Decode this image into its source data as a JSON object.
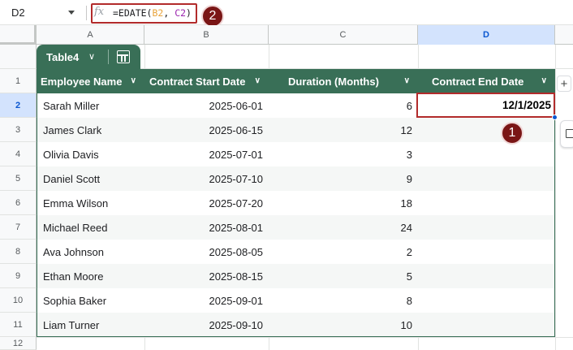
{
  "formula_bar": {
    "cell_ref": "D2",
    "fx_label": "fx",
    "formula_prefix": "=EDATE(",
    "arg1": "B2",
    "sep": ", ",
    "arg2": "C2",
    "formula_suffix": ")"
  },
  "markers": {
    "one": "1",
    "two": "2"
  },
  "columns": [
    "A",
    "B",
    "C",
    "D"
  ],
  "rows": [
    "1",
    "2",
    "3",
    "4",
    "5",
    "6",
    "7",
    "8",
    "9",
    "10",
    "11",
    "12"
  ],
  "table": {
    "name": "Table4",
    "headers": [
      "Employee Name",
      "Contract Start Date",
      "Duration (Months)",
      "Contract End Date"
    ],
    "rows": [
      [
        "Sarah Miller",
        "2025-06-01",
        "6",
        "12/1/2025"
      ],
      [
        "James Clark",
        "2025-06-15",
        "12",
        ""
      ],
      [
        "Olivia Davis",
        "2025-07-01",
        "3",
        ""
      ],
      [
        "Daniel Scott",
        "2025-07-10",
        "9",
        ""
      ],
      [
        "Emma Wilson",
        "2025-07-20",
        "18",
        ""
      ],
      [
        "Michael Reed",
        "2025-08-01",
        "24",
        ""
      ],
      [
        "Ava Johnson",
        "2025-08-05",
        "2",
        ""
      ],
      [
        "Ethan Moore",
        "2025-08-15",
        "5",
        ""
      ],
      [
        "Sophia Baker",
        "2025-09-01",
        "8",
        ""
      ],
      [
        "Liam Turner",
        "2025-09-10",
        "10",
        ""
      ]
    ]
  },
  "add_column_label": "+",
  "colors": {
    "table_header": "#396f57",
    "band_light": "#ffffff",
    "band_alt": "#f5f7f6",
    "highlight": "#b22b2b",
    "selection": "#d3e3fd"
  }
}
